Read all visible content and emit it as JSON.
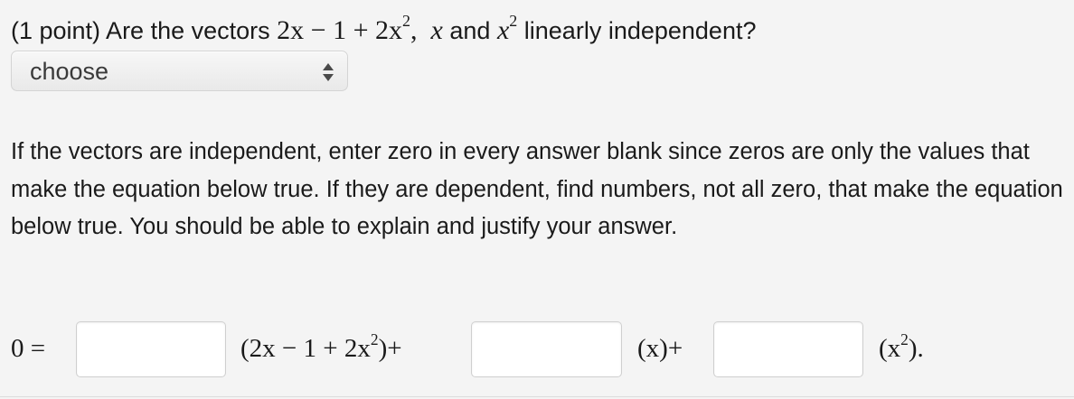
{
  "question": {
    "prefix": "(1 point) Are the vectors",
    "vector1": "2x − 1 + 2x",
    "vector1_exp": "2",
    "comma": ",",
    "vector2": "x",
    "conjunction": "and",
    "vector3": "x",
    "vector3_exp": "2",
    "suffix": "linearly independent?"
  },
  "dropdown": {
    "selected": "choose",
    "icon": "updown-arrows-icon"
  },
  "instructions": "If the vectors are independent, enter zero in every answer blank since zeros are only the values that make the equation below true. If they are dependent, find numbers, not all zero, that make the equation below true. You should be able to explain and justify your answer.",
  "equation": {
    "lhs": "0 =",
    "term1_open": "(2x − 1 + 2x",
    "term1_exp": "2",
    "term1_close": ")+",
    "term2": "(x)+",
    "term3_open": "(x",
    "term3_exp": "2",
    "term3_close": ").",
    "blank1_value": "",
    "blank2_value": "",
    "blank3_value": ""
  }
}
